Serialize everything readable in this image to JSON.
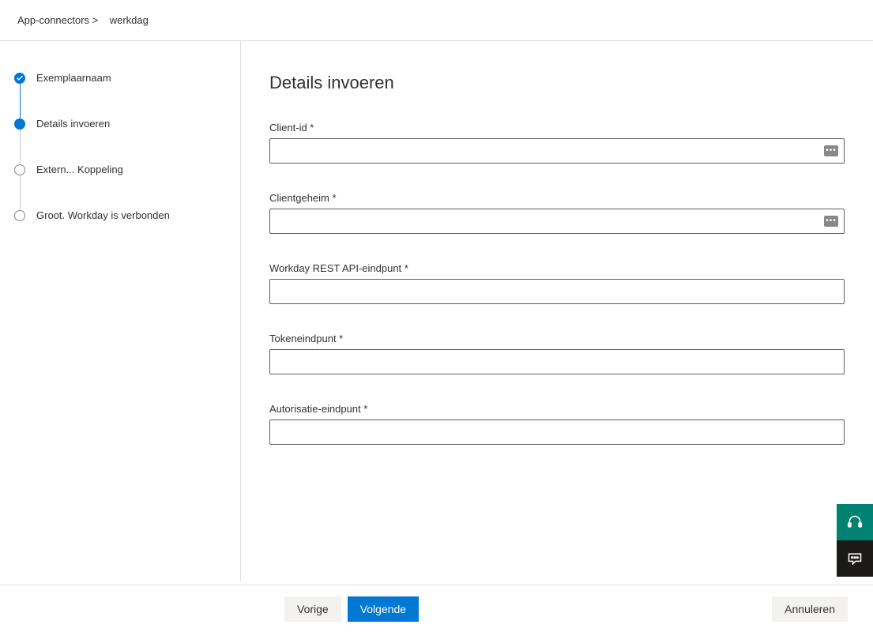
{
  "header": {
    "breadcrumb_prefix": "App-connectors >",
    "breadcrumb_current": "werkdag"
  },
  "steps": [
    {
      "label": "Exemplaarnaam",
      "state": "completed"
    },
    {
      "label": "Details invoeren",
      "state": "current"
    },
    {
      "label": "Extern... Koppeling",
      "state": "pending"
    },
    {
      "label": "Groot. Workday is verbonden",
      "state": "pending"
    }
  ],
  "main": {
    "title": "Details invoeren",
    "fields": {
      "client_id": {
        "label": "Client-id *",
        "value": "",
        "masked": true
      },
      "client_secret": {
        "label": "Clientgeheim *",
        "value": "",
        "masked": true
      },
      "rest_api": {
        "label": "Workday REST API-eindpunt *",
        "value": "",
        "masked": false
      },
      "token": {
        "label": "Tokeneindpunt *",
        "value": "",
        "masked": false
      },
      "auth": {
        "label": "Autorisatie-eindpunt *",
        "value": "",
        "masked": false
      }
    }
  },
  "footer": {
    "prev": "Vorige",
    "next": "Volgende",
    "cancel": "Annuleren"
  },
  "float": {
    "help_icon": "help-headset-icon",
    "feedback_icon": "feedback-chat-icon"
  }
}
